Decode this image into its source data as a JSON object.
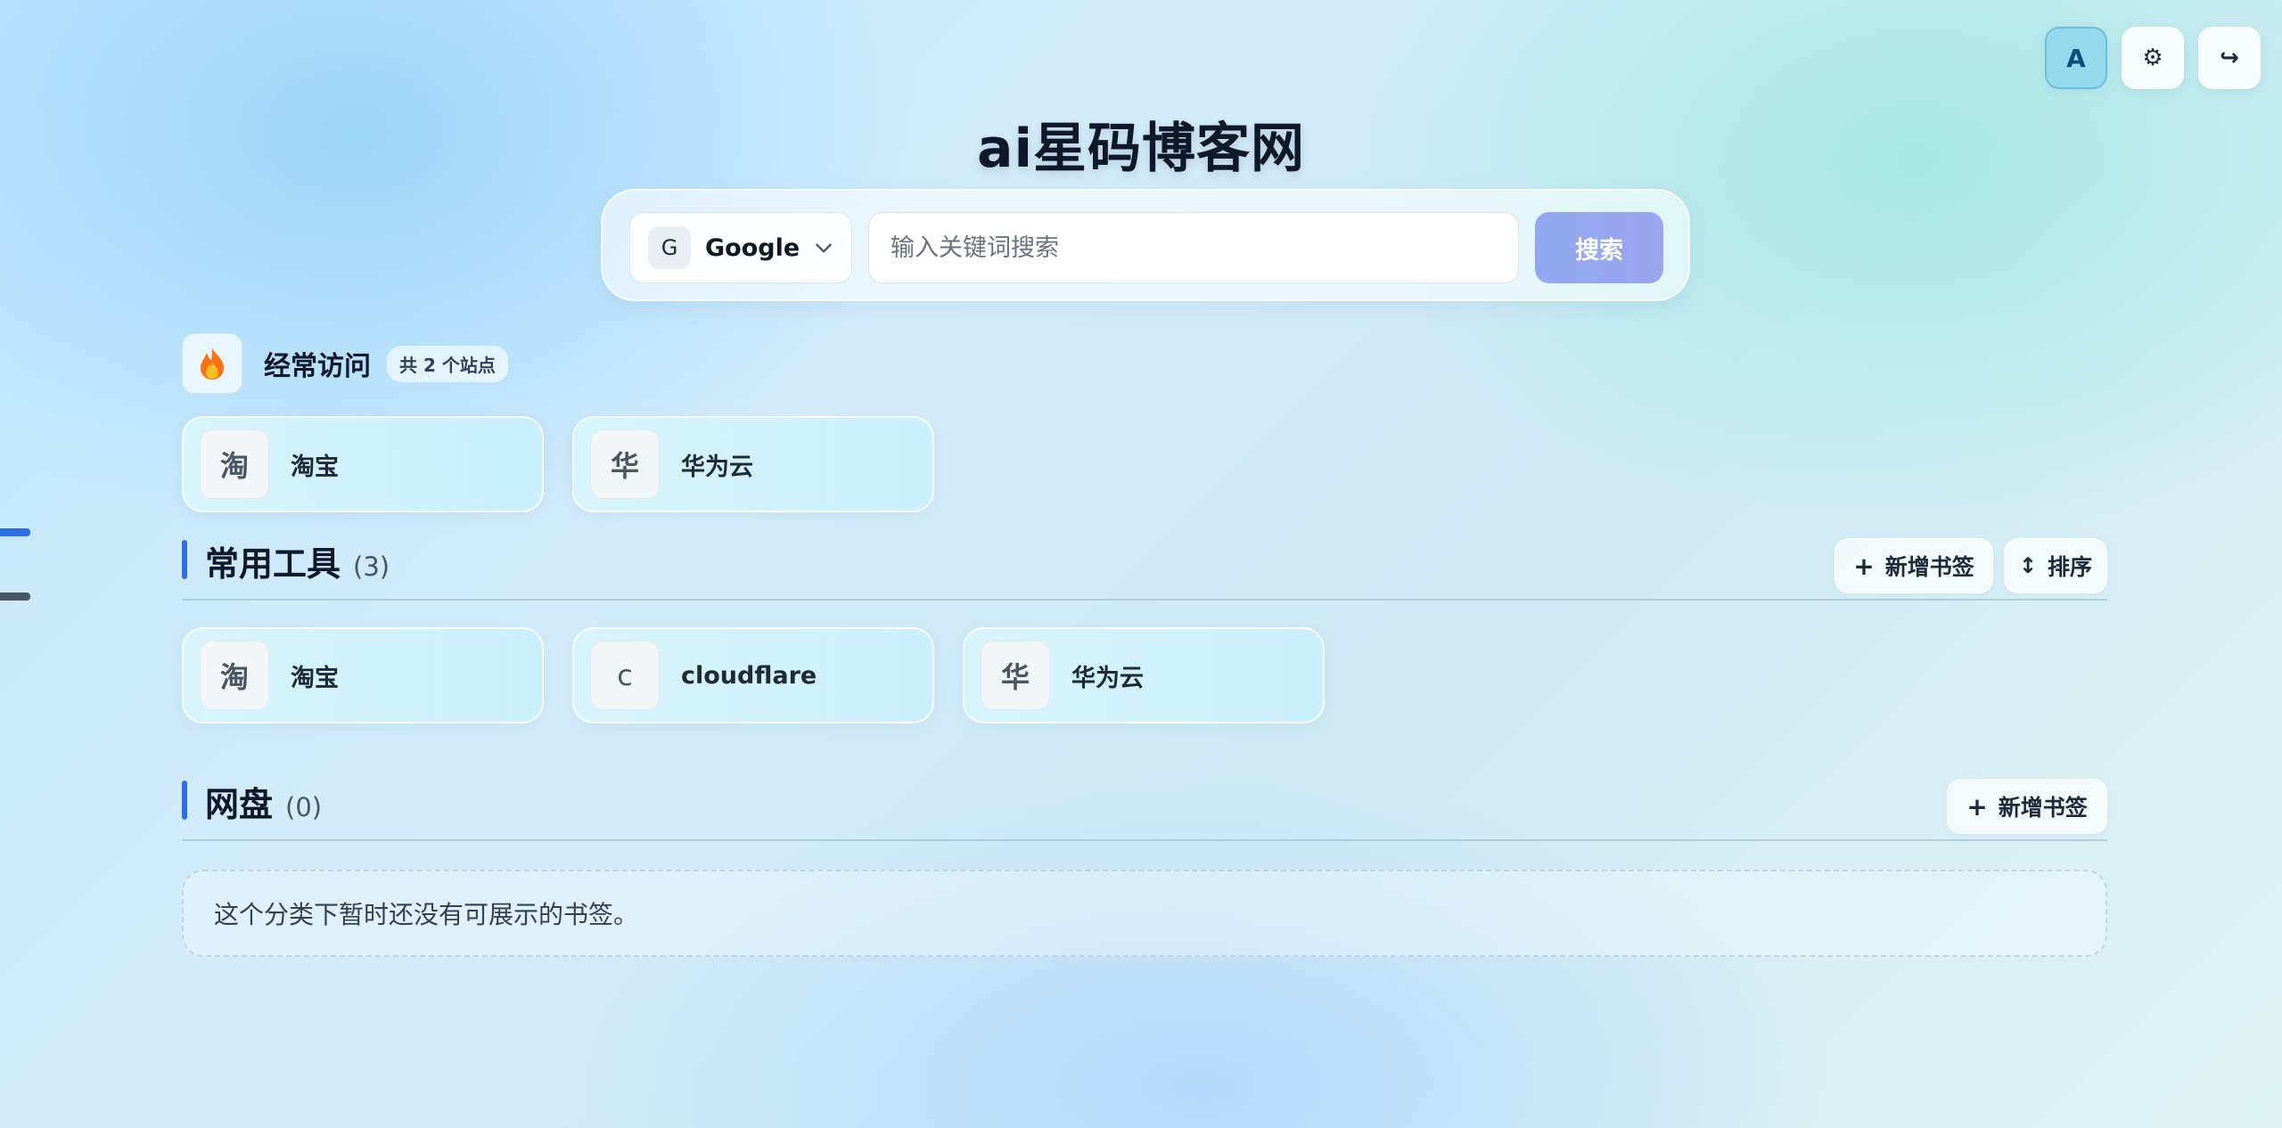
{
  "header": {
    "title": "ai星码博客网",
    "avatar_letter": "A",
    "settings_icon": "gear-icon",
    "logout_icon": "logout-arrow-icon"
  },
  "search": {
    "engine_badge": "G",
    "engine_name": "Google",
    "placeholder": "输入关键词搜索",
    "value": "",
    "button_label": "搜索"
  },
  "frequent": {
    "icon": "fire-icon",
    "title": "经常访问",
    "count_label": "共 2 个站点",
    "items": [
      {
        "icon_char": "淘",
        "name": "淘宝"
      },
      {
        "icon_char": "华",
        "name": "华为云"
      }
    ]
  },
  "groups": [
    {
      "title": "常用工具",
      "count": "(3)",
      "add_label": "新增书签",
      "sort_label": "排序",
      "items": [
        {
          "icon_char": "淘",
          "name": "淘宝"
        },
        {
          "icon_char": "c",
          "name": "cloudflare"
        },
        {
          "icon_char": "华",
          "name": "华为云"
        }
      ]
    },
    {
      "title": "网盘",
      "count": "(0)",
      "add_label": "新增书签",
      "empty_text": "这个分类下暂时还没有可展示的书签。"
    }
  ],
  "colors": {
    "accent": "#2f6ee6",
    "search_button": "#95a8f0",
    "card_bg": "#d2f2fb"
  }
}
